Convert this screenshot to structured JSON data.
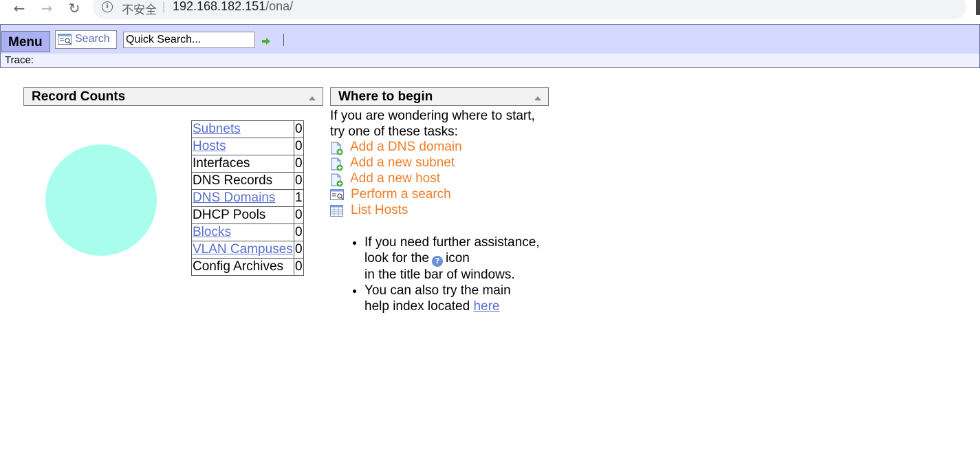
{
  "browser": {
    "insecure_label": "不安全",
    "separator": "|",
    "url_host": "192.168.182.151",
    "url_path": "/ona/"
  },
  "menubar": {
    "menu_label": "Menu",
    "search_label": "Search",
    "quick_search_value": "Quick Search...",
    "trace_label": "Trace:"
  },
  "record_counts": {
    "title": "Record Counts",
    "rows": [
      {
        "label": "Subnets",
        "count": "0",
        "link": true
      },
      {
        "label": "Hosts",
        "count": "0",
        "link": true
      },
      {
        "label": "Interfaces",
        "count": "0",
        "link": false
      },
      {
        "label": "DNS Records",
        "count": "0",
        "link": false
      },
      {
        "label": "DNS Domains",
        "count": "1",
        "link": true
      },
      {
        "label": "DHCP Pools",
        "count": "0",
        "link": false
      },
      {
        "label": "Blocks",
        "count": "0",
        "link": true
      },
      {
        "label": "VLAN Campuses",
        "count": "0",
        "link": true
      },
      {
        "label": "Config Archives",
        "count": "0",
        "link": false
      }
    ],
    "pie_color": "#a9fdec"
  },
  "where_to_begin": {
    "title": "Where to begin",
    "intro_line1": "If you are wondering where to start,",
    "intro_line2": "try one of these tasks:",
    "tasks": [
      {
        "label": "Add a DNS domain",
        "icon": "add-page-icon"
      },
      {
        "label": "Add a new subnet",
        "icon": "add-page-icon"
      },
      {
        "label": "Add a new host",
        "icon": "add-page-icon"
      },
      {
        "label": "Perform a search",
        "icon": "search-form-icon"
      },
      {
        "label": "List Hosts",
        "icon": "list-table-icon"
      }
    ],
    "help1_line1": "If you need further assistance,",
    "help1_pre": "look for the",
    "help1_post": "icon",
    "help1_line3": "in the title bar of windows.",
    "help2_line1": "You can also try the main",
    "help2_pre": "help index located",
    "help2_link": "here"
  },
  "colors": {
    "task_link": "#f07d28",
    "link": "#5a6fcf",
    "menubar_bg": "#d5d9ff"
  }
}
